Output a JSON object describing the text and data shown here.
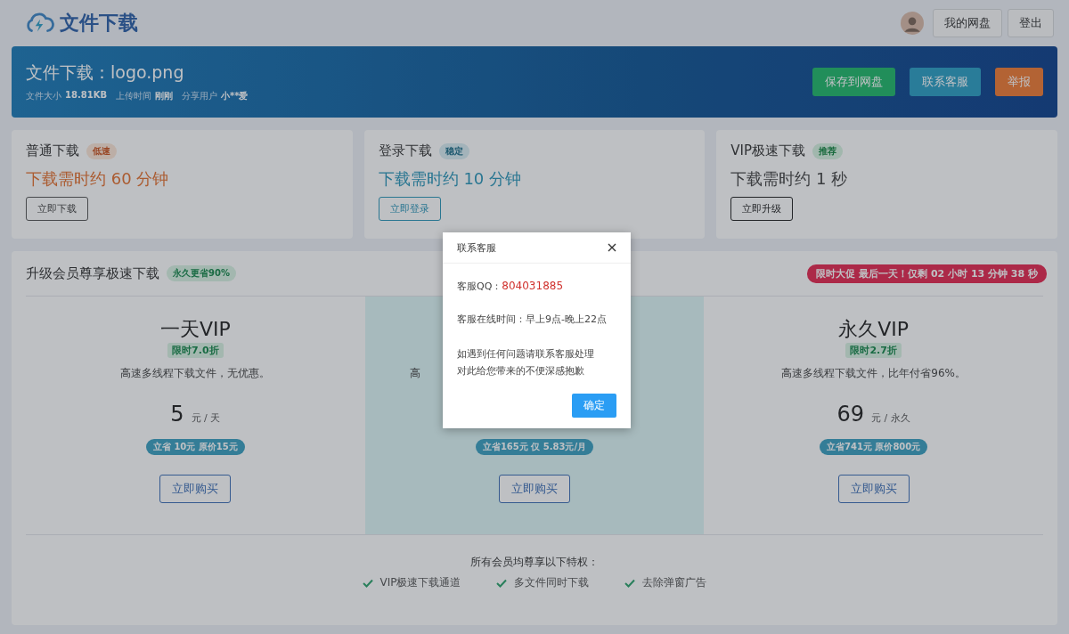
{
  "header": {
    "logo": "文件下载",
    "buttons": [
      "我的网盘",
      "登出"
    ]
  },
  "file": {
    "title": "文件下载：logo.png",
    "meta": [
      {
        "label": "文件大小",
        "value": "18.81KB"
      },
      {
        "label": "上传时间",
        "value": "刚刚"
      },
      {
        "label": "分享用户",
        "value": "小**爱"
      }
    ],
    "actions": [
      {
        "label": "保存到网盘",
        "kind": "save"
      },
      {
        "label": "联系客服",
        "kind": "service"
      },
      {
        "label": "举报",
        "kind": "report"
      }
    ]
  },
  "options": [
    {
      "kind": "normal",
      "title": "普通下载",
      "tag": "低速",
      "time": "下载需时约 60 分钟",
      "button": "立即下载"
    },
    {
      "kind": "login",
      "title": "登录下载",
      "tag": "稳定",
      "time": "下载需时约 10 分钟",
      "button": "立即登录"
    },
    {
      "kind": "vip",
      "title": "VIP极速下载",
      "tag": "推荐",
      "time": "下载需时约 1 秒",
      "button": "立即升级"
    }
  ],
  "membership": {
    "title": "升级会员尊享极速下载",
    "tag": "永久更省90%",
    "countdown": "限时大促 最后一天！仅剩 02 小时 13 分钟 38 秒",
    "plans": [
      {
        "name": "一天VIP",
        "tag": "限时7.0折",
        "desc": "高速多线程下载文件，无优惠。",
        "price": "5",
        "unit": "元 / 天",
        "saving": "立省 10元 原价15元",
        "button": "立即购买",
        "highlighted": false
      },
      {
        "desc": "高",
        "saving": "立省165元 仅 5.83元/月",
        "button": "立即购买",
        "highlighted": true
      },
      {
        "name": "永久VIP",
        "tag": "限时2.7折",
        "desc": "高速多线程下载文件，比年付省96%。",
        "price": "69",
        "unit": "元 / 永久",
        "saving": "立省741元 原价800元",
        "button": "立即购买",
        "highlighted": false
      }
    ],
    "benefits_title": "所有会员均尊享以下特权：",
    "benefits": [
      "VIP极速下载通道",
      "多文件同时下载",
      "去除弹窗广告"
    ]
  },
  "dialog": {
    "title": "联系客服",
    "qq_label": "客服QQ：",
    "qq": "804031885",
    "hours": "客服在线时间：早上9点-晚上22点",
    "notes": [
      "如遇到任何问题请联系客服处理",
      "对此给您带来的不便深感抱歉"
    ],
    "confirm": "确定"
  }
}
